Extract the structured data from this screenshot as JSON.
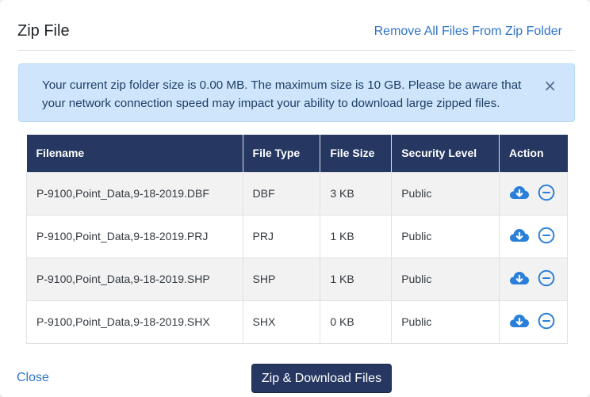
{
  "header": {
    "title": "Zip File",
    "remove_all_label": "Remove All Files From Zip Folder"
  },
  "alert": {
    "message": "Your current zip folder size is 0.00 MB. The maximum size is 10 GB. Please be aware that your network connection speed may impact your ability to download large zipped files.",
    "close_glyph": "×"
  },
  "table": {
    "columns": [
      "Filename",
      "File Type",
      "File Size",
      "Security Level",
      "Action"
    ],
    "rows": [
      {
        "filename": "P-9100,Point_Data,9-18-2019.DBF",
        "type": "DBF",
        "size": "3 KB",
        "security": "Public"
      },
      {
        "filename": "P-9100,Point_Data,9-18-2019.PRJ",
        "type": "PRJ",
        "size": "1 KB",
        "security": "Public"
      },
      {
        "filename": "P-9100,Point_Data,9-18-2019.SHP",
        "type": "SHP",
        "size": "1 KB",
        "security": "Public"
      },
      {
        "filename": "P-9100,Point_Data,9-18-2019.SHX",
        "type": "SHX",
        "size": "0 KB",
        "security": "Public"
      }
    ],
    "action_icons": [
      "cloud-download-icon",
      "remove-circle-icon"
    ]
  },
  "footer": {
    "close_label": "Close",
    "zip_button_label": "Zip & Download Files"
  },
  "colors": {
    "primary_dark": "#263862",
    "link": "#2e74c9",
    "alert_bg": "#cfe5fb",
    "alert_text": "#1d3f66",
    "stripe": "#f2f2f2"
  }
}
